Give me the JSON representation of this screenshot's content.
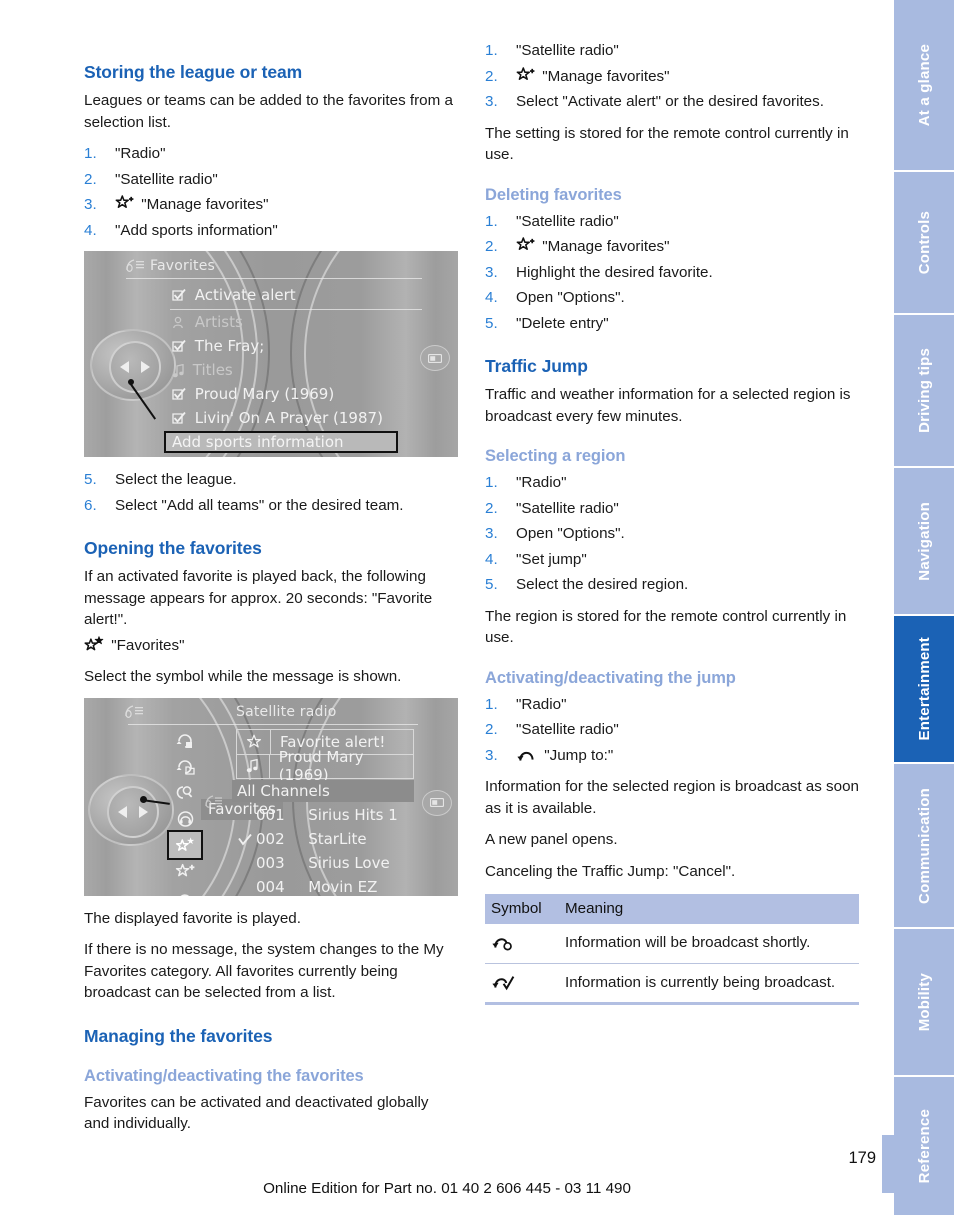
{
  "page": {
    "number": "179",
    "footer_note": "Online Edition for Part no. 01 40 2 606 445 - 03 11 490"
  },
  "rail": {
    "tabs": [
      {
        "label": "At a glance",
        "active": false
      },
      {
        "label": "Controls",
        "active": false
      },
      {
        "label": "Driving tips",
        "active": false
      },
      {
        "label": "Navigation",
        "active": false
      },
      {
        "label": "Entertainment",
        "active": true
      },
      {
        "label": "Communication",
        "active": false
      },
      {
        "label": "Mobility",
        "active": false
      },
      {
        "label": "Reference",
        "active": false
      }
    ]
  },
  "left_column": {
    "storing": {
      "heading": "Storing the league or team",
      "intro": "Leagues or teams can be added to the favorites from a selection list.",
      "steps": [
        {
          "num": "1.",
          "text": "\"Radio\""
        },
        {
          "num": "2.",
          "text": "\"Satellite radio\""
        },
        {
          "num": "3.",
          "text": "\"Manage favorites\"",
          "icon": "star-plus-icon"
        },
        {
          "num": "4.",
          "text": "\"Add sports information\""
        }
      ],
      "steps_after": [
        {
          "num": "5.",
          "text": "Select the league."
        },
        {
          "num": "6.",
          "text": "Select \"Add all teams\" or the desired team."
        }
      ]
    },
    "display_favorites": {
      "header_title": "Favorites",
      "rows": [
        {
          "text": "Activate alert",
          "icon": "checkbox-checked-icon",
          "dim": false
        },
        {
          "text": "Artists",
          "icon": "artist-icon",
          "dim": true
        },
        {
          "text": "The Fray;",
          "icon": "checkbox-checked-icon",
          "dim": false
        },
        {
          "text": "Titles",
          "icon": "note-icon",
          "dim": true
        },
        {
          "text": "Proud Mary (1969)",
          "icon": "checkbox-checked-icon",
          "dim": false
        },
        {
          "text": "Livin' On A Prayer (1987)",
          "icon": "checkbox-checked-icon",
          "dim": false
        }
      ],
      "selected_entry": "Add sports information"
    },
    "opening": {
      "heading": "Opening the favorites",
      "para1": "If an activated favorite is played back, the following message appears for approx. 20 seconds: \"Favorite alert!\".",
      "symbol_line": "\"Favorites\"",
      "symbol_icon": "star-star-icon",
      "para2": "Select the symbol while the message is shown."
    },
    "display_satradio": {
      "header_title": "Satellite radio",
      "message_star": "Favorite alert!",
      "message_track": "Proud Mary (1969)",
      "list_header": "All Channels",
      "tooltip": "Favorites",
      "channels": [
        {
          "num": "001",
          "name": "Sirius Hits 1",
          "checked": false
        },
        {
          "num": "002",
          "name": "StarLite",
          "checked": true
        },
        {
          "num": "003",
          "name": "Sirius Love",
          "checked": false
        },
        {
          "num": "004",
          "name": "Movin EZ",
          "checked": false
        }
      ],
      "side_icons": [
        "repeat-track-icon",
        "repeat-folder-icon",
        "search-icon",
        "headphones-icon",
        "star-star-icon",
        "star-plus-icon",
        "jump-arc-icon"
      ]
    },
    "after_display": {
      "para1": "The displayed favorite is played.",
      "para2": "If there is no message, the system changes to the My Favorites category. All favorites currently being broadcast can be selected from a list."
    },
    "managing": {
      "heading": "Managing the favorites",
      "sub_heading": "Activating/deactivating the favorites",
      "para": "Favorites can be activated and deactivated globally and individually."
    }
  },
  "right_column": {
    "activating_steps": [
      {
        "num": "1.",
        "text": "\"Satellite radio\""
      },
      {
        "num": "2.",
        "text": "\"Manage favorites\"",
        "icon": "star-plus-icon"
      },
      {
        "num": "3.",
        "text": "Select \"Activate alert\" or the desired favorites."
      }
    ],
    "activating_note": "The setting is stored for the remote control currently in use.",
    "deleting": {
      "heading": "Deleting favorites",
      "steps": [
        {
          "num": "1.",
          "text": "\"Satellite radio\""
        },
        {
          "num": "2.",
          "text": "\"Manage favorites\"",
          "icon": "star-plus-icon"
        },
        {
          "num": "3.",
          "text": "Highlight the desired favorite."
        },
        {
          "num": "4.",
          "text": "Open \"Options\"."
        },
        {
          "num": "5.",
          "text": "\"Delete entry\""
        }
      ]
    },
    "traffic_jump": {
      "heading": "Traffic Jump",
      "intro": "Traffic and weather information for a selected region is broadcast every few minutes."
    },
    "selecting_region": {
      "heading": "Selecting a region",
      "steps": [
        {
          "num": "1.",
          "text": "\"Radio\""
        },
        {
          "num": "2.",
          "text": "\"Satellite radio\""
        },
        {
          "num": "3.",
          "text": "Open \"Options\"."
        },
        {
          "num": "4.",
          "text": "\"Set jump\""
        },
        {
          "num": "5.",
          "text": "Select the desired region."
        }
      ],
      "note": "The region is stored for the remote control currently in use."
    },
    "activating_jump": {
      "heading": "Activating/deactivating the jump",
      "steps": [
        {
          "num": "1.",
          "text": "\"Radio\""
        },
        {
          "num": "2.",
          "text": "\"Satellite radio\""
        },
        {
          "num": "3.",
          "text": "\"Jump to:\"",
          "icon": "jump-arc-icon"
        }
      ],
      "para1": "Information for the selected region is broadcast as soon as it is available.",
      "para2": "A new panel opens.",
      "para3": "Canceling the Traffic Jump: \"Cancel\"."
    },
    "symbol_table": {
      "headers": [
        "Symbol",
        "Meaning"
      ],
      "rows": [
        {
          "icon": "jump-clock-icon",
          "meaning": "Information will be broadcast shortly."
        },
        {
          "icon": "jump-check-icon",
          "meaning": "Information is currently being broadcast."
        }
      ]
    }
  },
  "colors": {
    "heading_primary": "#1b62b5",
    "heading_secondary": "#8ba6d9",
    "step_number": "#2a7fd4",
    "rail_inactive": "#a8bae0",
    "rail_active": "#1b62b5",
    "table_header": "#b2bfe2"
  }
}
